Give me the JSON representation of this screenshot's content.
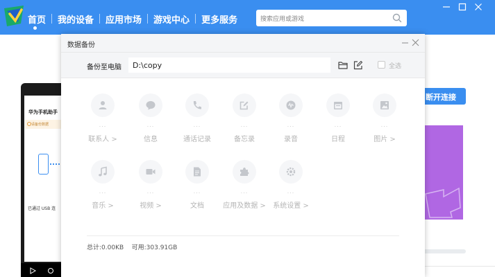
{
  "header": {
    "nav": [
      {
        "label": "首页",
        "active": true
      },
      {
        "label": "我的设备"
      },
      {
        "label": "应用市场"
      },
      {
        "label": "游戏中心"
      },
      {
        "label": "更多服务"
      }
    ],
    "search_placeholder": "搜索应用或游戏",
    "accent_color": "#3a8ef0"
  },
  "background": {
    "phone_title": "华为手机助手",
    "phone_warning": "请备份数据",
    "phone_usb_text": "已通过 USB 连",
    "disconnect_label": "断开连接"
  },
  "dialog": {
    "title": "数据备份",
    "backup_to_label": "备份至电脑",
    "path_value": "D:\\copy",
    "select_all_label": "全选",
    "categories": [
      {
        "label": "联系人 >",
        "dots": "...",
        "icon": "contacts-icon"
      },
      {
        "label": "信息",
        "dots": "...",
        "icon": "message-icon"
      },
      {
        "label": "通话记录",
        "dots": "...",
        "icon": "call-log-icon"
      },
      {
        "label": "备忘录",
        "dots": "...",
        "icon": "memo-icon"
      },
      {
        "label": "录音",
        "dots": "...",
        "icon": "recording-icon"
      },
      {
        "label": "日程",
        "dots": "...",
        "icon": "calendar-icon"
      },
      {
        "label": "图片 >",
        "dots": "...",
        "icon": "picture-icon"
      },
      {
        "label": "音乐 >",
        "dots": "...",
        "icon": "music-icon"
      },
      {
        "label": "视频 >",
        "dots": "...",
        "icon": "video-icon"
      },
      {
        "label": "文档",
        "dots": "...",
        "icon": "document-icon"
      },
      {
        "label": "应用及数据 >",
        "dots": "...",
        "icon": "apps-icon"
      },
      {
        "label": "系统设置 >",
        "dots": "...",
        "icon": "settings-icon"
      }
    ],
    "footer": {
      "total_label": "总计:",
      "total_value": "0.00KB",
      "available_label": "可用:",
      "available_value": "303.91GB"
    }
  }
}
